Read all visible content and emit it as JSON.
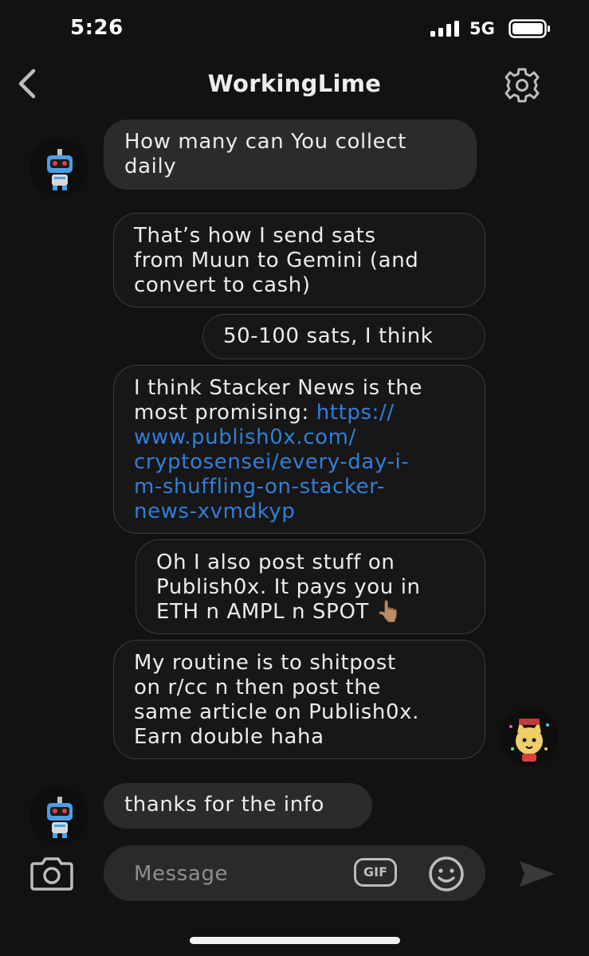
{
  "status_bar": {
    "time": "5:26",
    "network": "5G"
  },
  "nav": {
    "title": "WorkingLime",
    "back_icon": "chevron-left-icon",
    "settings_icon": "gear-icon"
  },
  "messages": [
    {
      "direction": "incoming",
      "text": "How many can You collect\ndaily"
    },
    {
      "direction": "outgoing",
      "text": "That’s how I send sats\nfrom Muun to Gemini (and\nconvert to cash)"
    },
    {
      "direction": "outgoing",
      "text": "50-100 sats, I think"
    },
    {
      "direction": "outgoing",
      "text_lead": "I think Stacker News is the\nmost promising: ",
      "link": "https://\nwww.publish0x.com/\ncryptosensei/every-day-i-\nm-shuffling-on-stacker-\nnews-xvmdkyp"
    },
    {
      "direction": "outgoing",
      "text": "Oh I also post stuff on\nPublish0x. It pays you in\nETH n AMPL n SPOT 👆🏽"
    },
    {
      "direction": "outgoing",
      "text": "My routine is to shitpost\non r/cc n then post the\nsame article on Publish0x.\nEarn double haha"
    },
    {
      "direction": "incoming",
      "text": "thanks for the info"
    }
  ],
  "composer": {
    "placeholder": "Message",
    "gif_label": "GIF",
    "camera_icon": "camera-icon",
    "emoji_icon": "smiley-icon",
    "send_icon": "send-icon"
  },
  "colors": {
    "background": "#121212",
    "incoming_bubble": "#2b2b2b",
    "outgoing_bubble_border": "#3c3c3c",
    "link": "#2f7fdc"
  }
}
